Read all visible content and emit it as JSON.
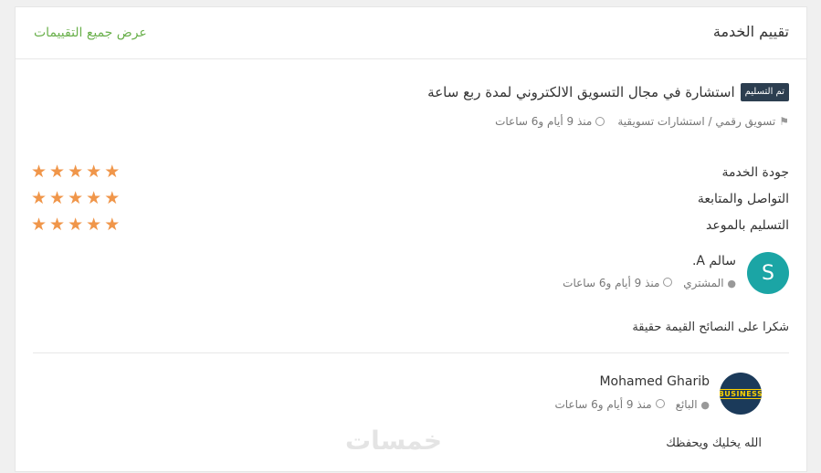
{
  "header": {
    "title": "تقييم الخدمة",
    "view_all": "عرض جميع التقييمات"
  },
  "service": {
    "badge": "تم التسليم",
    "title": "استشارة في مجال التسويق الالكتروني لمدة ربع ساعة",
    "category": "تسويق رقمي / استشارات تسويقية",
    "time": "منذ 9 أيام و6 ساعات"
  },
  "ratings": [
    {
      "label": "جودة الخدمة",
      "stars": 5
    },
    {
      "label": "التواصل والمتابعة",
      "stars": 5
    },
    {
      "label": "التسليم بالموعد",
      "stars": 5
    }
  ],
  "review": {
    "avatar_letter": "S",
    "name": "سالم A.",
    "role": "المشتري",
    "time": "منذ 9 أيام و6 ساعات",
    "text": "شكرا على النصائح القيمة حقيقة"
  },
  "reply": {
    "avatar_text": "BUSINESS",
    "name": "Mohamed Gharib",
    "role": "البائع",
    "time": "منذ 9 أيام و6 ساعات",
    "text": "الله يخليك ويحفظك"
  },
  "watermark": "خمسات",
  "colors": {
    "accent_green": "#6ab04c",
    "star": "#f0964a",
    "badge_bg": "#2c3e50",
    "avatar_teal": "#1ba5a5"
  }
}
